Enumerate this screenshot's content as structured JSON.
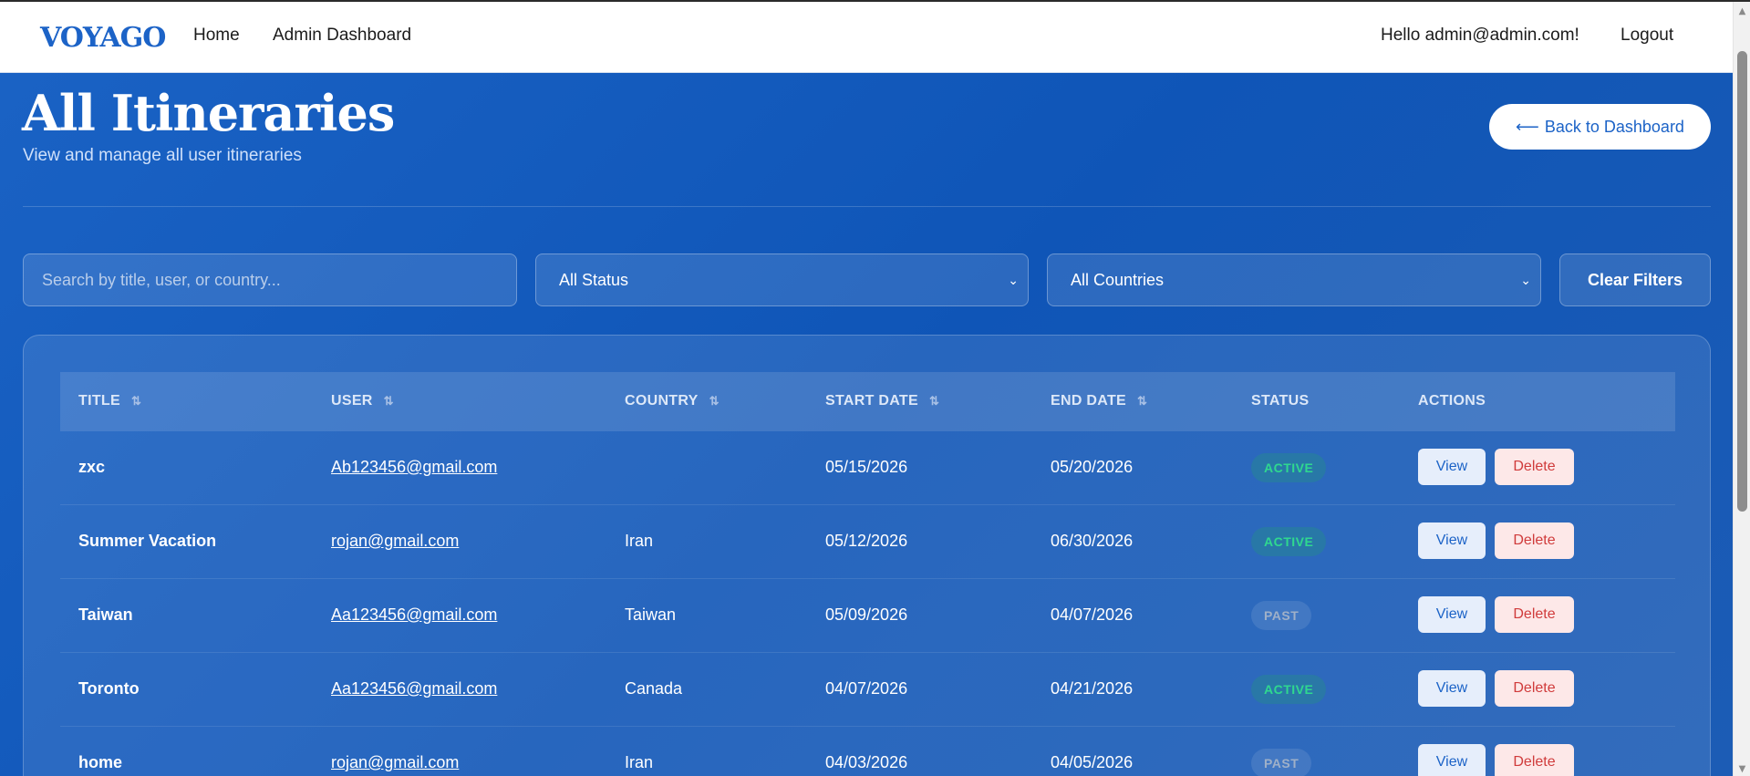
{
  "nav": {
    "logo": "VOYAGO",
    "home": "Home",
    "admin_dashboard": "Admin Dashboard",
    "greeting": "Hello admin@admin.com!",
    "logout": "Logout"
  },
  "page": {
    "title": "All Itineraries",
    "subtitle": "View and manage all user itineraries",
    "back_label": "Back to Dashboard",
    "back_arrow": "⟵"
  },
  "filters": {
    "search_placeholder": "Search by title, user, or country...",
    "status_selected": "All Status",
    "country_selected": "All Countries",
    "clear_label": "Clear Filters"
  },
  "table": {
    "headers": {
      "title": "TITLE",
      "user": "USER",
      "country": "COUNTRY",
      "start_date": "START DATE",
      "end_date": "END DATE",
      "status": "STATUS",
      "actions": "ACTIONS"
    },
    "rows": [
      {
        "title": "zxc",
        "user": "Ab123456@gmail.com",
        "country": "",
        "start_date": "05/15/2026",
        "end_date": "05/20/2026",
        "status": "ACTIVE"
      },
      {
        "title": "Summer Vacation",
        "user": "rojan@gmail.com",
        "country": "Iran",
        "start_date": "05/12/2026",
        "end_date": "06/30/2026",
        "status": "ACTIVE"
      },
      {
        "title": "Taiwan",
        "user": "Aa123456@gmail.com",
        "country": "Taiwan",
        "start_date": "05/09/2026",
        "end_date": "04/07/2026",
        "status": "PAST"
      },
      {
        "title": "Toronto",
        "user": "Aa123456@gmail.com",
        "country": "Canada",
        "start_date": "04/07/2026",
        "end_date": "04/21/2026",
        "status": "ACTIVE"
      },
      {
        "title": "home",
        "user": "rojan@gmail.com",
        "country": "Iran",
        "start_date": "04/03/2026",
        "end_date": "04/05/2026",
        "status": "PAST"
      }
    ],
    "view_label": "View",
    "delete_label": "Delete"
  },
  "colors": {
    "brand": "#1c63c7",
    "active": "#2fd88f",
    "delete": "#d03b3b"
  }
}
